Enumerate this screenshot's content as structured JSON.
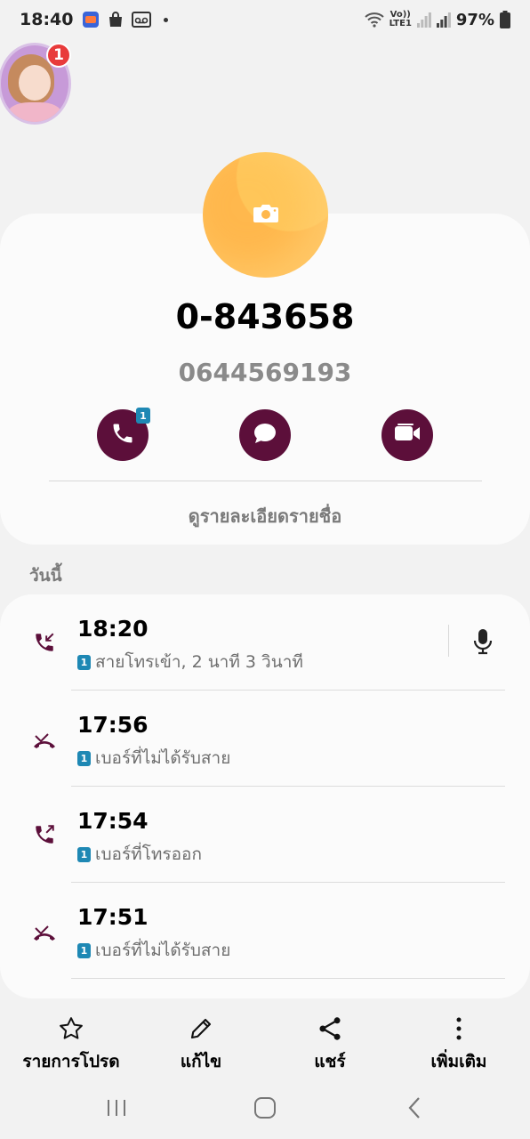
{
  "status_bar": {
    "time": "18:40",
    "battery": "97%",
    "network_label": "LTE1"
  },
  "floating_bubble": {
    "badge_count": "1"
  },
  "contact": {
    "name": "0-843658",
    "number": "0644569193",
    "call_sim_badge": "1",
    "view_details_label": "ดูรายละเอียดรายชื่อ"
  },
  "history": {
    "section_label": "วันนี้",
    "entries": [
      {
        "time": "18:20",
        "sim": "1",
        "description": "สายโทรเข้า, 2 นาที 3 วินาที",
        "type": "incoming"
      },
      {
        "time": "17:56",
        "sim": "1",
        "description": "เบอร์ที่ไม่ได้รับสาย",
        "type": "missed"
      },
      {
        "time": "17:54",
        "sim": "1",
        "description": "เบอร์ที่โทรออก",
        "type": "outgoing"
      },
      {
        "time": "17:51",
        "sim": "1",
        "description": "เบอร์ที่ไม่ได้รับสาย",
        "type": "missed"
      }
    ]
  },
  "bottom_actions": {
    "favorites": "รายการโปรด",
    "edit": "แก้ไข",
    "share": "แชร์",
    "more": "เพิ่มเติม"
  },
  "colors": {
    "accent": "#5c0f3a",
    "photo": "#ffb84d",
    "sim_badge": "#1e88b4",
    "notification_badge": "#e83b3b"
  }
}
